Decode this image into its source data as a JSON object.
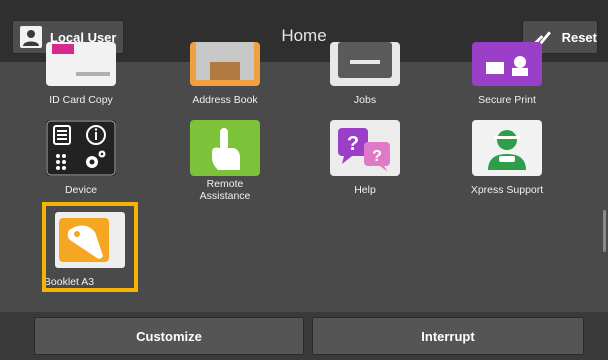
{
  "header": {
    "user_label": "Local User",
    "title": "Home",
    "reset_label": "Reset"
  },
  "apps": [
    {
      "label": "ID Card Copy",
      "icon": "id-card-copy-icon"
    },
    {
      "label": "Address Book",
      "icon": "address-book-icon"
    },
    {
      "label": "Jobs",
      "icon": "jobs-icon"
    },
    {
      "label": "Secure Print",
      "icon": "secure-print-icon"
    },
    {
      "label": "Device",
      "icon": "device-icon"
    },
    {
      "label": "Remote\nAssistance",
      "icon": "remote-assistance-icon"
    },
    {
      "label": "Help",
      "icon": "help-icon"
    },
    {
      "label": "Xpress Support",
      "icon": "xpress-support-icon"
    },
    {
      "label": "Booklet A3",
      "icon": "booklet-a3-icon"
    }
  ],
  "footer": {
    "customize_label": "Customize",
    "interrupt_label": "Interrupt"
  },
  "colors": {
    "highlight": "#f5b400",
    "background": "#4a4a4a",
    "header": "#2f2f2f"
  }
}
